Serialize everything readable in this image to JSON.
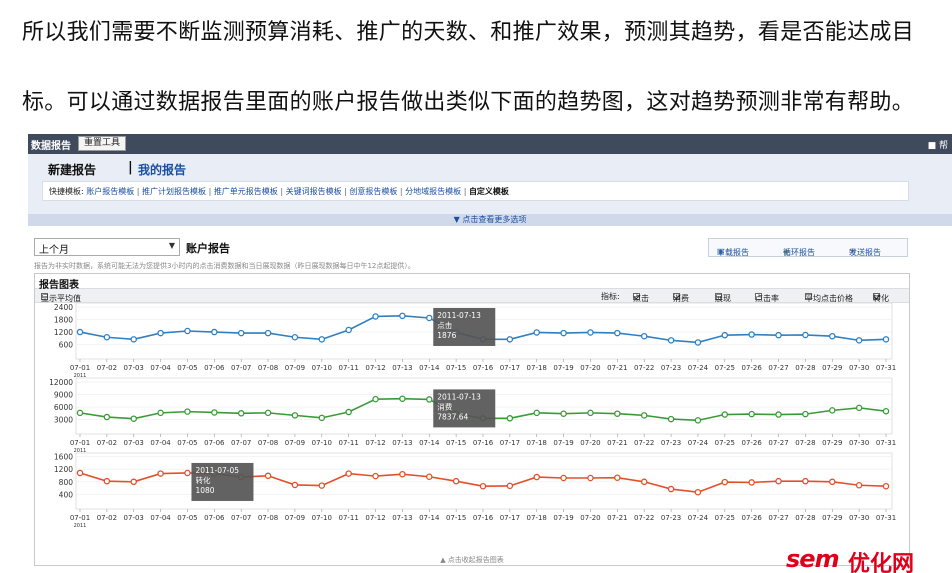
{
  "article": {
    "line1": "所以我们需要不断监测预算消耗、推广的天数、和推广效果，预测其趋势，看是否能达成目",
    "line2": "标。可以通过数据报告里面的账户报告做出类似下面的趋势图，这对趋势预测非常有帮助。"
  },
  "app": {
    "title": "数据报告",
    "reset_button": "重置工具",
    "top_icon": "■ 帮",
    "new_report": "新建报告",
    "separator": "|",
    "my_reports": "我的报告",
    "shortcut_label": "快捷模板:",
    "templates": [
      "账户报告模板",
      "推广计划报告模板",
      "推广单元报告模板",
      "关键词报告模板",
      "创意报告模板",
      "分地域报告模板"
    ],
    "template_current": "自定义模板",
    "expand_more": "▼ 点击查看更多选项"
  },
  "report": {
    "range": "上个月",
    "title": "账户报告",
    "download": "下载报告",
    "cycle": "循环报告",
    "send": "发送报告",
    "notice": "报告为非实时数据，系统可能无法为您提供3小时内的点击消费数据和当日展现数据（昨日展现数据每日中午12点起提供）。",
    "chart_title": "报告图表",
    "show_avg": "显示平均值",
    "metrics_label": "指标:",
    "metrics": [
      {
        "label": "点击",
        "checked": true
      },
      {
        "label": "消费",
        "checked": true
      },
      {
        "label": "展现",
        "checked": false
      },
      {
        "label": "点击率",
        "checked": false
      },
      {
        "label": "平均点击价格",
        "checked": false
      },
      {
        "label": "转化",
        "checked": true
      }
    ],
    "collapse": "▲ 点击收起报告图表"
  },
  "chart_data": [
    {
      "type": "line",
      "series": [
        {
          "name": "点击",
          "values": [
            1200,
            950,
            850,
            1150,
            1250,
            1200,
            1150,
            1150,
            950,
            850,
            1300,
            1950,
            1980,
            1876,
            1180,
            850,
            850,
            1180,
            1150,
            1180,
            1150,
            1000,
            800,
            700,
            1050,
            1080,
            1050,
            1060,
            1000,
            800,
            850
          ]
        }
      ],
      "x": [
        "07-01",
        "07-02",
        "07-03",
        "07-04",
        "07-05",
        "07-06",
        "07-07",
        "07-08",
        "07-09",
        "07-10",
        "07-11",
        "07-12",
        "07-13",
        "07-14",
        "07-15",
        "07-16",
        "07-17",
        "07-18",
        "07-19",
        "07-20",
        "07-21",
        "07-22",
        "07-23",
        "07-24",
        "07-25",
        "07-26",
        "07-27",
        "07-28",
        "07-29",
        "07-30",
        "07-31"
      ],
      "x_year": "2011",
      "yticks": [
        600,
        1200,
        1800,
        2400
      ],
      "ylim": [
        0,
        2500
      ],
      "color": "#2f7fc1",
      "tooltip": {
        "date": "2011-07-13",
        "metric": "点击",
        "value": "1876",
        "index": 13
      }
    },
    {
      "type": "line",
      "series": [
        {
          "name": "消费",
          "values": [
            4600,
            3600,
            3200,
            4600,
            4900,
            4700,
            4500,
            4600,
            4000,
            3400,
            4800,
            7900,
            8000,
            7837.64,
            4400,
            3300,
            3300,
            4600,
            4400,
            4600,
            4400,
            4000,
            3100,
            2800,
            4200,
            4300,
            4200,
            4300,
            5200,
            5800,
            5000
          ]
        }
      ],
      "x": [
        "07-01",
        "07-02",
        "07-03",
        "07-04",
        "07-05",
        "07-06",
        "07-07",
        "07-08",
        "07-09",
        "07-10",
        "07-11",
        "07-12",
        "07-13",
        "07-14",
        "07-15",
        "07-16",
        "07-17",
        "07-18",
        "07-19",
        "07-20",
        "07-21",
        "07-22",
        "07-23",
        "07-24",
        "07-25",
        "07-26",
        "07-27",
        "07-28",
        "07-29",
        "07-30",
        "07-31"
      ],
      "x_year": "2011",
      "yticks": [
        3000,
        6000,
        9000,
        12000
      ],
      "ylim": [
        0,
        12500
      ],
      "color": "#3a9a3a",
      "tooltip": {
        "date": "2011-07-13",
        "metric": "消费",
        "value": "7837.64",
        "index": 13
      }
    },
    {
      "type": "line",
      "series": [
        {
          "name": "转化",
          "values": [
            1080,
            820,
            800,
            1060,
            1080,
            1060,
            950,
            990,
            700,
            680,
            1060,
            980,
            1040,
            960,
            820,
            660,
            670,
            950,
            920,
            920,
            930,
            800,
            570,
            470,
            790,
            780,
            820,
            820,
            800,
            690,
            660
          ]
        }
      ],
      "x": [
        "07-01",
        "07-02",
        "07-03",
        "07-04",
        "07-05",
        "07-06",
        "07-07",
        "07-08",
        "07-09",
        "07-10",
        "07-11",
        "07-12",
        "07-13",
        "07-14",
        "07-15",
        "07-16",
        "07-17",
        "07-18",
        "07-19",
        "07-20",
        "07-21",
        "07-22",
        "07-23",
        "07-24",
        "07-25",
        "07-26",
        "07-27",
        "07-28",
        "07-29",
        "07-30",
        "07-31"
      ],
      "x_year": "2011",
      "yticks": [
        400,
        800,
        1200,
        1600
      ],
      "ylim": [
        0,
        1650
      ],
      "color": "#e2502a",
      "tooltip": {
        "date": "2011-07-05",
        "metric": "转化",
        "value": "1080",
        "index": 4
      }
    }
  ],
  "watermark": {
    "sem": "sem",
    "site": "优化网"
  },
  "icons": [
    "download-icon",
    "cycle-icon",
    "mail-icon",
    "checkbox-icon",
    "dropdown-arrow-icon"
  ]
}
